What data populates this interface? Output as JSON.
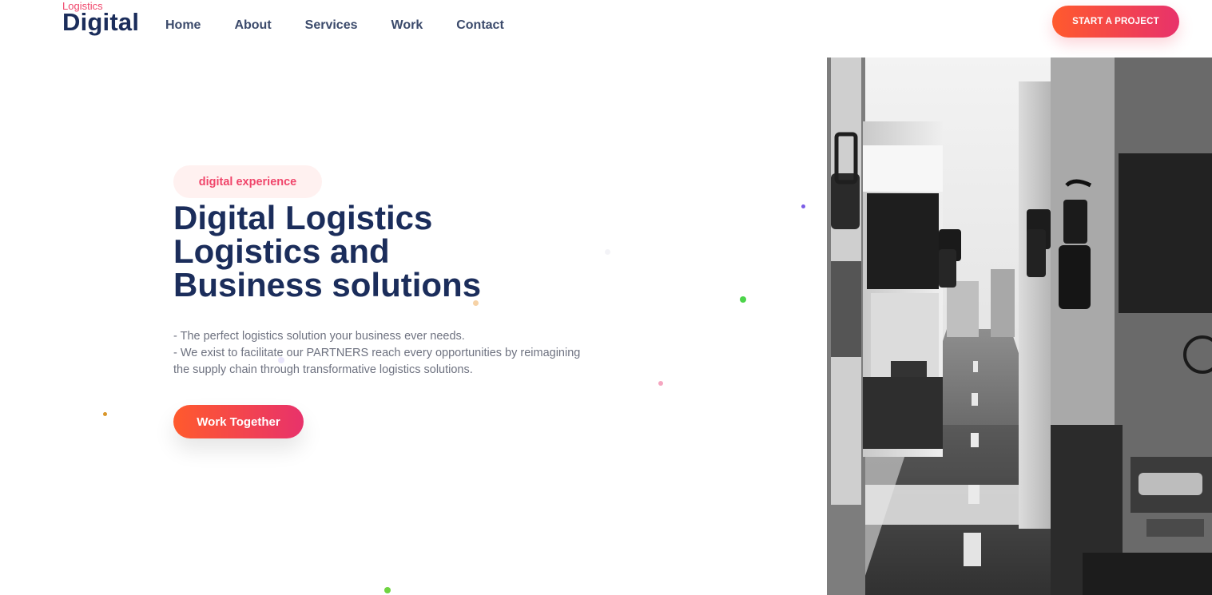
{
  "header": {
    "logo_small": "Logistics",
    "logo_big": "Digital",
    "nav": [
      "Home",
      "About",
      "Services",
      "Work",
      "Contact"
    ],
    "cta_label": "START A PROJECT"
  },
  "hero": {
    "badge": "digital experience",
    "headline_lines": [
      "Digital Logistics",
      "Logistics and",
      "Business solutions"
    ],
    "description_lines": [
      "- The perfect logistics solution your business ever needs.",
      "- We exist to facilitate our PARTNERS reach every opportunities by reimagining",
      "the supply chain through transformative logistics solutions."
    ],
    "cta_label": "Work Together"
  },
  "image": {
    "subject": "trucks-on-highway-photo",
    "style": "grayscale"
  },
  "colors": {
    "brand_navy": "#1b2d5b",
    "accent_pink": "#f0456a",
    "gradient_start": "#ff5a2d",
    "gradient_end": "#e8326b",
    "badge_bg": "#fff1f0",
    "body_text": "#6e7280"
  }
}
